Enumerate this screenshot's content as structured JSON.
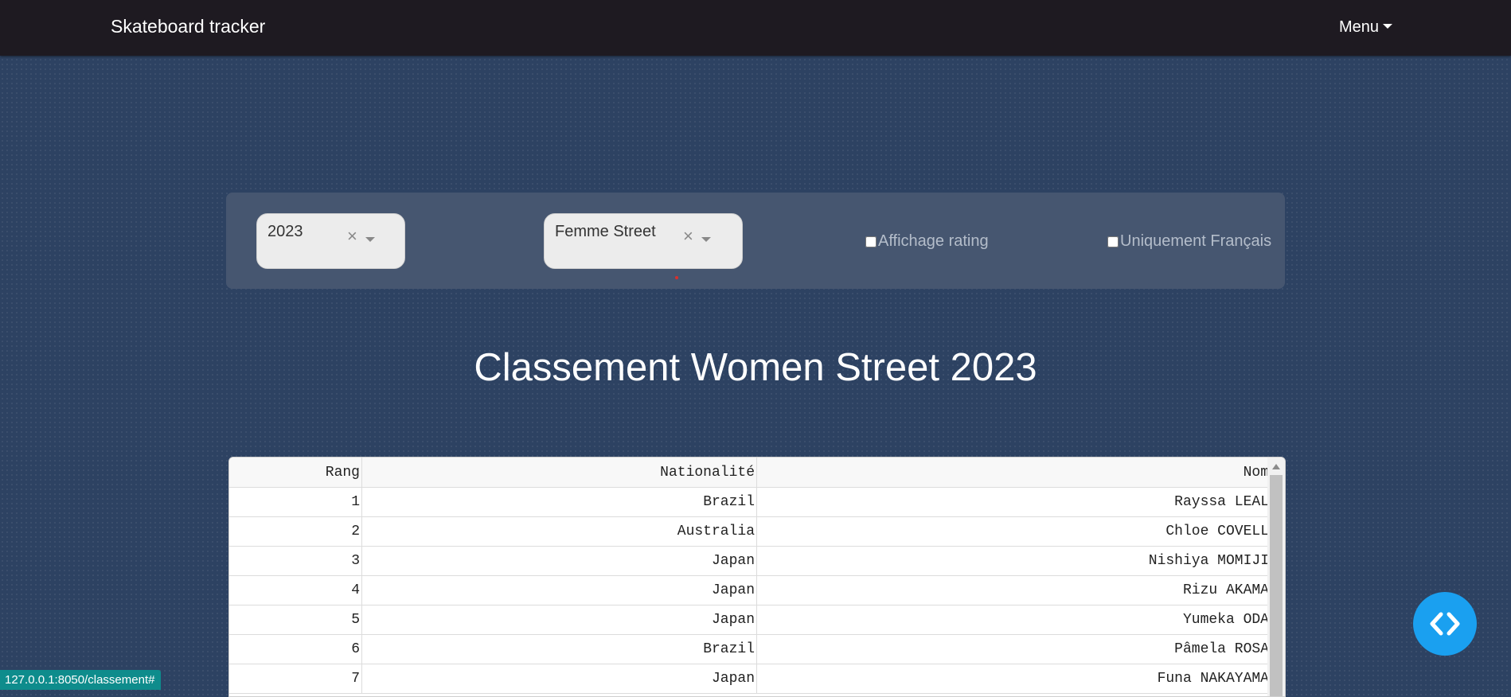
{
  "navbar": {
    "brand": "Skateboard tracker",
    "menu_label": "Menu"
  },
  "hero": {
    "text": "CLASSEMENT"
  },
  "filters": {
    "year": {
      "value": "2023",
      "clear": "×"
    },
    "category": {
      "value": "Femme Street",
      "clear": "×"
    },
    "show_rating": {
      "label": "Affichage rating",
      "checked": false
    },
    "french_only": {
      "label": "Uniquement Français",
      "checked": false
    }
  },
  "page_title": "Classement Women Street 2023",
  "table": {
    "headers": [
      "Rang",
      "Nationalité",
      "Nom"
    ],
    "rows": [
      [
        "1",
        "Brazil",
        "Rayssa LEAL"
      ],
      [
        "2",
        "Australia",
        "Chloe COVELL"
      ],
      [
        "3",
        "Japan",
        "Nishiya MOMIJI"
      ],
      [
        "4",
        "Japan",
        "Rizu AKAMA"
      ],
      [
        "5",
        "Japan",
        "Yumeka ODA"
      ],
      [
        "6",
        "Brazil",
        "Pâmela ROSA"
      ],
      [
        "7",
        "Japan",
        "Funa NAKAYAMA"
      ]
    ]
  },
  "status_url": "127.0.0.1:8050/classement#",
  "colors": {
    "navbar": "#1e1a21",
    "background": "#2d4262",
    "panel": "#465670",
    "fab": "#1aa0f0"
  },
  "icons": {
    "menu_caret": "caret-down-icon",
    "select_arrow": "chevron-down-icon",
    "fab": "code-brackets-icon"
  }
}
